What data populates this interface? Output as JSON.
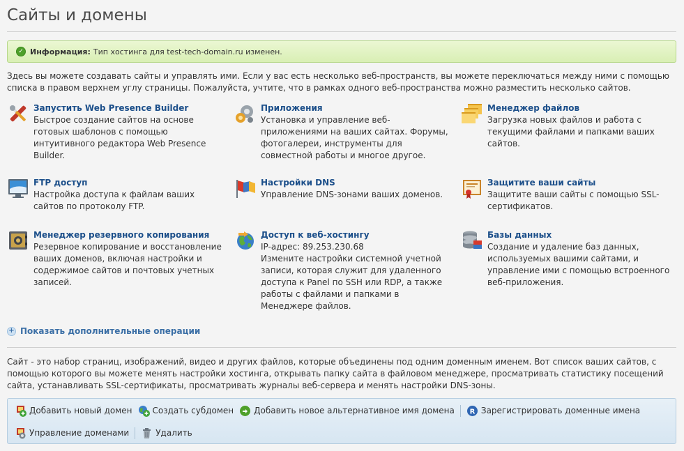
{
  "page": {
    "title": "Сайты и домены"
  },
  "info": {
    "label": "Информация:",
    "message": "Тип хостинга для test-tech-domain.ru изменен."
  },
  "intro": "Здесь вы можете создавать сайты и управлять ими. Если у вас есть несколько веб-пространств, вы можете переключаться между ними с помощью списка в правом верхнем углу страницы. Пожалуйста, учтите, что в рамках одного веб-пространства можно разместить несколько сайтов.",
  "features": [
    {
      "icon": "web-builder-icon",
      "title": "Запустить Web Presence Builder",
      "desc": "Быстрое создание сайтов на основе готовых шаблонов с помощью интуитивного редактора Web Presence Builder."
    },
    {
      "icon": "applications-icon",
      "title": "Приложения",
      "desc": "Установка и управление веб-приложениями на ваших сайтах. Форумы, фотогалереи, инструменты для совместной работы и многое другое."
    },
    {
      "icon": "file-manager-icon",
      "title": "Менеджер файлов",
      "desc": "Загрузка новых файлов и работа с текущими файлами и папками ваших сайтов."
    },
    {
      "icon": "ftp-icon",
      "title": "FTP доступ",
      "desc": "Настройка доступа к файлам ваших сайтов по протоколу FTP."
    },
    {
      "icon": "dns-icon",
      "title": "Настройки DNS",
      "desc": "Управление DNS-зонами ваших доменов."
    },
    {
      "icon": "certificate-icon",
      "title": "Защитите ваши сайты",
      "desc": "Защитите ваши сайты с помощью SSL-сертификатов."
    },
    {
      "icon": "backup-icon",
      "title": "Менеджер резервного копирования",
      "desc": "Резервное копирование и восстановление ваших доменов, включая настройки и содержимое сайтов и почтовых учетных записей."
    },
    {
      "icon": "web-hosting-access-icon",
      "title": "Доступ к веб-хостингу",
      "sub": "IP-адрес: 89.253.230.68",
      "desc": "Измените настройки системной учетной записи, которая служит для удаленного доступа к Panel по SSH или RDP, а также работы с файлами и папками в Менеджере файлов."
    },
    {
      "icon": "databases-icon",
      "title": "Базы данных",
      "desc": "Создание и удаление баз данных, используемых вашими сайтами, и управление ими с помощью встроенного веб-приложения."
    }
  ],
  "more_operations": "Показать дополнительные операции",
  "sites_description": "Сайт - это набор страниц, изображений, видео и других файлов, которые объединены под одним доменным именем. Вот список ваших сайтов, с помощью которого вы можете менять настройки хостинга, открывать папку сайта в файловом менеджере, просматривать статистику посещений сайта, устанавливать SSL-сертификаты, просматривать журналы веб-сервера и менять настройки DNS-зоны.",
  "toolbar": {
    "add_domain": "Добавить новый домен",
    "create_subdomain": "Создать субдомен",
    "add_alias": "Добавить новое альтернативное имя домена",
    "register_domains": "Зарегистрировать доменные имена",
    "manage_domains": "Управление доменами",
    "delete": "Удалить"
  },
  "colors": {
    "link": "#1c4f8a",
    "info_bg": "#d9efb4",
    "toolbar_bg": "#d7e6f2"
  }
}
